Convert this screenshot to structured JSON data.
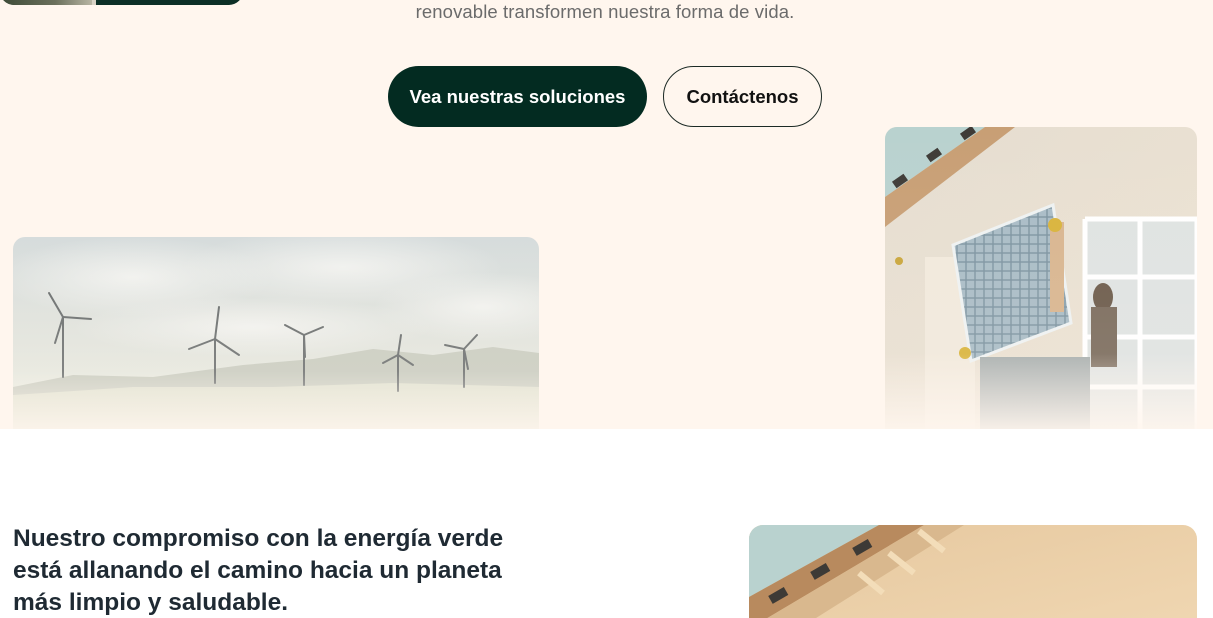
{
  "hero": {
    "subtitle": "renovable transformen nuestra forma de vida.",
    "buttons": {
      "primary_label": "Vea nuestras soluciones",
      "secondary_label": "Contáctenos"
    },
    "images": {
      "top_card": "people-photo-card",
      "wind": "wind-turbines-photo",
      "solar": "solar-panel-installer-photo"
    }
  },
  "commitment": {
    "title": "Nuestro compromiso con la energía verde está allanando el camino hacia un planeta más limpio y saludable.",
    "image": "solar-panel-roof-photo"
  },
  "colors": {
    "hero_background": "#fff6ee",
    "primary_button": "#032b21",
    "heading": "#1f2a33",
    "subtitle": "#6b6b6b"
  }
}
